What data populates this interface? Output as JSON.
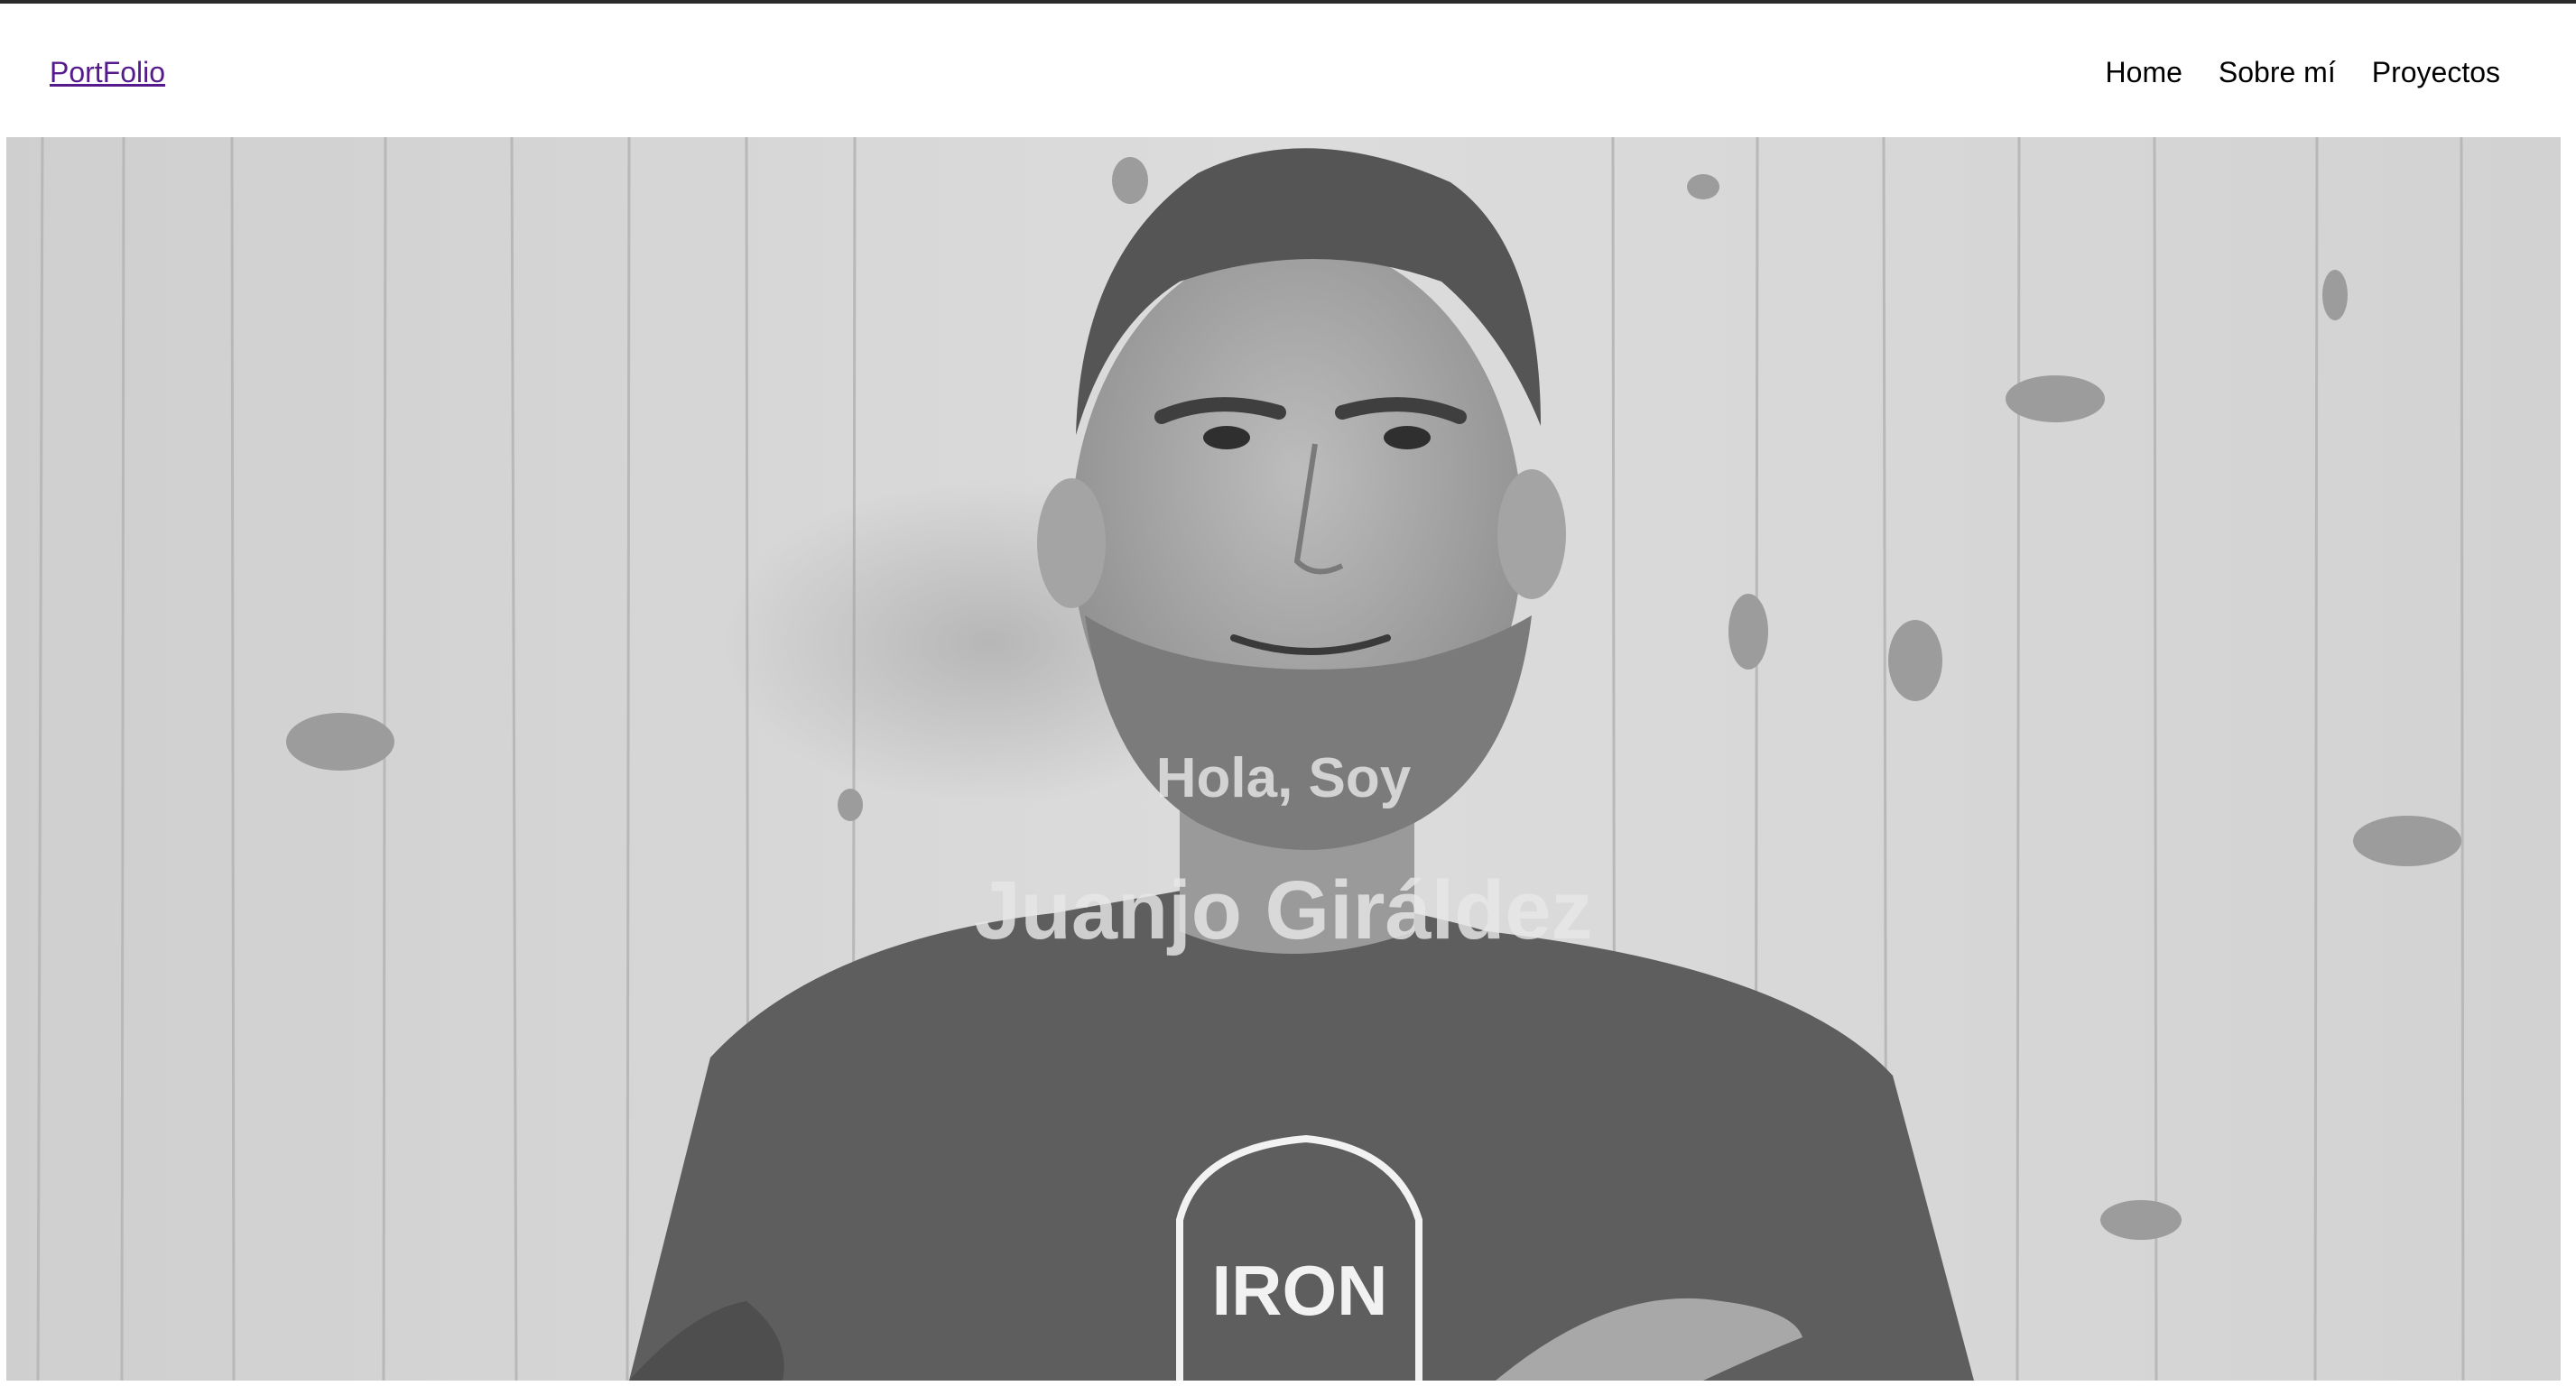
{
  "navbar": {
    "brand": "PortFolio",
    "links": [
      "Home",
      "Sobre mí",
      "Proyectos"
    ]
  },
  "hero": {
    "greeting": "Hola, Soy",
    "name": "Juanjo Giráldez",
    "shirt_logo_text": "IRON"
  },
  "colors": {
    "brand_link": "#551a8b",
    "nav_text": "#000000",
    "hero_text": "#e6e6e6"
  }
}
